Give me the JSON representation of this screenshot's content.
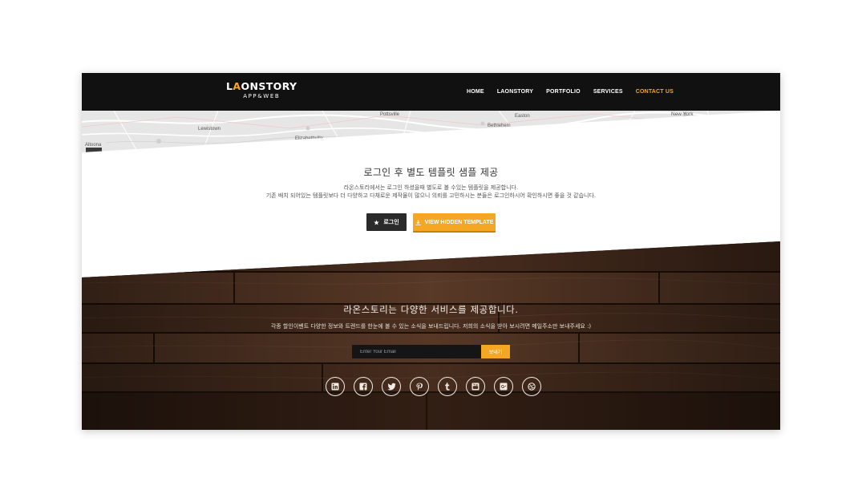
{
  "header": {
    "logo_prefix": "L",
    "logo_accent": "A",
    "logo_rest": "ONSTORY",
    "logo_sub": "APP&WEB",
    "nav": [
      {
        "label": "HOME",
        "active": false
      },
      {
        "label": "LAONSTORY",
        "active": false
      },
      {
        "label": "PORTFOLIO",
        "active": false
      },
      {
        "label": "SERVICES",
        "active": false
      },
      {
        "label": "CONTACT US",
        "active": true
      }
    ]
  },
  "map": {
    "place_labels": [
      "Altoona",
      "Pottsville",
      "Bethlehem",
      "Easton",
      "Lewistown",
      "Elizabethville",
      "New York"
    ]
  },
  "template_section": {
    "title": "로그인 후 별도 템플릿 샘플 제공",
    "desc_line1": "라온스토리에서는 로그인 하셨을때 별도로 볼 수있는 템플릿을 제공합니다.",
    "desc_line2": "기존 배치 되어있는 템플릿보다 더 다양하고 다채로운 제작물이 많으니 의뢰를 고민하시는 분들은 로그인하시어 확인하시면 좋을 것 같습니다.",
    "login_button": {
      "label": "로그인",
      "icon": "star-icon"
    },
    "hidden_button": {
      "label": "VIEW HIDDEN TEMPLATE",
      "icon": "download-icon"
    }
  },
  "subscribe_section": {
    "title": "라온스토리는 다양한 서비스를 제공합니다.",
    "desc": "각종 할인이벤트 다양한 정보와 트렌드를 한눈에 볼 수 있는 소식을 보내드립니다. 저희의 소식을 받아 보시려면 메일주소만 보내주세요 :)",
    "email_placeholder": "Enter Your Email",
    "send_label": "보내기",
    "social_icons": [
      "linkedin-icon",
      "facebook-icon",
      "twitter-icon",
      "pinterest-icon",
      "tumblr-icon",
      "youtube-icon",
      "google-plus-icon",
      "dribbble-icon"
    ]
  },
  "colors": {
    "accent": "#f5a623",
    "header_bg": "#111111",
    "wood_dark": "#3a2418",
    "wood_light": "#7a5236"
  }
}
